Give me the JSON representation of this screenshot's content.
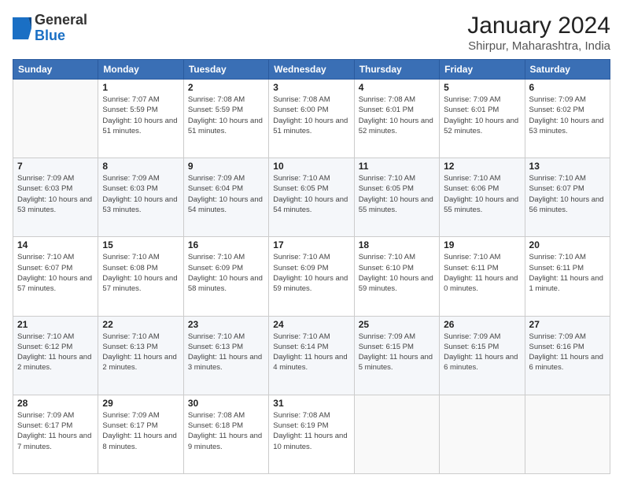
{
  "header": {
    "logo": {
      "general": "General",
      "blue": "Blue"
    },
    "title": "January 2024",
    "subtitle": "Shirpur, Maharashtra, India"
  },
  "calendar": {
    "days_of_week": [
      "Sunday",
      "Monday",
      "Tuesday",
      "Wednesday",
      "Thursday",
      "Friday",
      "Saturday"
    ],
    "weeks": [
      [
        {
          "day": "",
          "sunrise": "",
          "sunset": "",
          "daylight": ""
        },
        {
          "day": "1",
          "sunrise": "Sunrise: 7:07 AM",
          "sunset": "Sunset: 5:59 PM",
          "daylight": "Daylight: 10 hours and 51 minutes."
        },
        {
          "day": "2",
          "sunrise": "Sunrise: 7:08 AM",
          "sunset": "Sunset: 5:59 PM",
          "daylight": "Daylight: 10 hours and 51 minutes."
        },
        {
          "day": "3",
          "sunrise": "Sunrise: 7:08 AM",
          "sunset": "Sunset: 6:00 PM",
          "daylight": "Daylight: 10 hours and 51 minutes."
        },
        {
          "day": "4",
          "sunrise": "Sunrise: 7:08 AM",
          "sunset": "Sunset: 6:01 PM",
          "daylight": "Daylight: 10 hours and 52 minutes."
        },
        {
          "day": "5",
          "sunrise": "Sunrise: 7:09 AM",
          "sunset": "Sunset: 6:01 PM",
          "daylight": "Daylight: 10 hours and 52 minutes."
        },
        {
          "day": "6",
          "sunrise": "Sunrise: 7:09 AM",
          "sunset": "Sunset: 6:02 PM",
          "daylight": "Daylight: 10 hours and 53 minutes."
        }
      ],
      [
        {
          "day": "7",
          "sunrise": "Sunrise: 7:09 AM",
          "sunset": "Sunset: 6:03 PM",
          "daylight": "Daylight: 10 hours and 53 minutes."
        },
        {
          "day": "8",
          "sunrise": "Sunrise: 7:09 AM",
          "sunset": "Sunset: 6:03 PM",
          "daylight": "Daylight: 10 hours and 53 minutes."
        },
        {
          "day": "9",
          "sunrise": "Sunrise: 7:09 AM",
          "sunset": "Sunset: 6:04 PM",
          "daylight": "Daylight: 10 hours and 54 minutes."
        },
        {
          "day": "10",
          "sunrise": "Sunrise: 7:10 AM",
          "sunset": "Sunset: 6:05 PM",
          "daylight": "Daylight: 10 hours and 54 minutes."
        },
        {
          "day": "11",
          "sunrise": "Sunrise: 7:10 AM",
          "sunset": "Sunset: 6:05 PM",
          "daylight": "Daylight: 10 hours and 55 minutes."
        },
        {
          "day": "12",
          "sunrise": "Sunrise: 7:10 AM",
          "sunset": "Sunset: 6:06 PM",
          "daylight": "Daylight: 10 hours and 55 minutes."
        },
        {
          "day": "13",
          "sunrise": "Sunrise: 7:10 AM",
          "sunset": "Sunset: 6:07 PM",
          "daylight": "Daylight: 10 hours and 56 minutes."
        }
      ],
      [
        {
          "day": "14",
          "sunrise": "Sunrise: 7:10 AM",
          "sunset": "Sunset: 6:07 PM",
          "daylight": "Daylight: 10 hours and 57 minutes."
        },
        {
          "day": "15",
          "sunrise": "Sunrise: 7:10 AM",
          "sunset": "Sunset: 6:08 PM",
          "daylight": "Daylight: 10 hours and 57 minutes."
        },
        {
          "day": "16",
          "sunrise": "Sunrise: 7:10 AM",
          "sunset": "Sunset: 6:09 PM",
          "daylight": "Daylight: 10 hours and 58 minutes."
        },
        {
          "day": "17",
          "sunrise": "Sunrise: 7:10 AM",
          "sunset": "Sunset: 6:09 PM",
          "daylight": "Daylight: 10 hours and 59 minutes."
        },
        {
          "day": "18",
          "sunrise": "Sunrise: 7:10 AM",
          "sunset": "Sunset: 6:10 PM",
          "daylight": "Daylight: 10 hours and 59 minutes."
        },
        {
          "day": "19",
          "sunrise": "Sunrise: 7:10 AM",
          "sunset": "Sunset: 6:11 PM",
          "daylight": "Daylight: 11 hours and 0 minutes."
        },
        {
          "day": "20",
          "sunrise": "Sunrise: 7:10 AM",
          "sunset": "Sunset: 6:11 PM",
          "daylight": "Daylight: 11 hours and 1 minute."
        }
      ],
      [
        {
          "day": "21",
          "sunrise": "Sunrise: 7:10 AM",
          "sunset": "Sunset: 6:12 PM",
          "daylight": "Daylight: 11 hours and 2 minutes."
        },
        {
          "day": "22",
          "sunrise": "Sunrise: 7:10 AM",
          "sunset": "Sunset: 6:13 PM",
          "daylight": "Daylight: 11 hours and 2 minutes."
        },
        {
          "day": "23",
          "sunrise": "Sunrise: 7:10 AM",
          "sunset": "Sunset: 6:13 PM",
          "daylight": "Daylight: 11 hours and 3 minutes."
        },
        {
          "day": "24",
          "sunrise": "Sunrise: 7:10 AM",
          "sunset": "Sunset: 6:14 PM",
          "daylight": "Daylight: 11 hours and 4 minutes."
        },
        {
          "day": "25",
          "sunrise": "Sunrise: 7:09 AM",
          "sunset": "Sunset: 6:15 PM",
          "daylight": "Daylight: 11 hours and 5 minutes."
        },
        {
          "day": "26",
          "sunrise": "Sunrise: 7:09 AM",
          "sunset": "Sunset: 6:15 PM",
          "daylight": "Daylight: 11 hours and 6 minutes."
        },
        {
          "day": "27",
          "sunrise": "Sunrise: 7:09 AM",
          "sunset": "Sunset: 6:16 PM",
          "daylight": "Daylight: 11 hours and 6 minutes."
        }
      ],
      [
        {
          "day": "28",
          "sunrise": "Sunrise: 7:09 AM",
          "sunset": "Sunset: 6:17 PM",
          "daylight": "Daylight: 11 hours and 7 minutes."
        },
        {
          "day": "29",
          "sunrise": "Sunrise: 7:09 AM",
          "sunset": "Sunset: 6:17 PM",
          "daylight": "Daylight: 11 hours and 8 minutes."
        },
        {
          "day": "30",
          "sunrise": "Sunrise: 7:08 AM",
          "sunset": "Sunset: 6:18 PM",
          "daylight": "Daylight: 11 hours and 9 minutes."
        },
        {
          "day": "31",
          "sunrise": "Sunrise: 7:08 AM",
          "sunset": "Sunset: 6:19 PM",
          "daylight": "Daylight: 11 hours and 10 minutes."
        },
        {
          "day": "",
          "sunrise": "",
          "sunset": "",
          "daylight": ""
        },
        {
          "day": "",
          "sunrise": "",
          "sunset": "",
          "daylight": ""
        },
        {
          "day": "",
          "sunrise": "",
          "sunset": "",
          "daylight": ""
        }
      ]
    ]
  }
}
